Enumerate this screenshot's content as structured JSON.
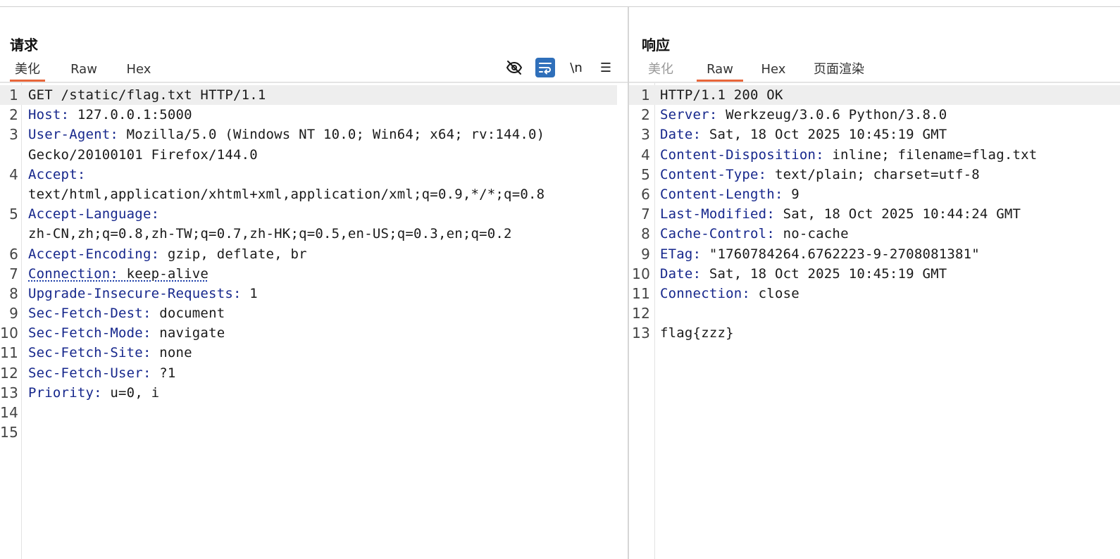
{
  "request": {
    "title": "请求",
    "tabs": [
      {
        "label": "美化",
        "active": true
      },
      {
        "label": "Raw",
        "active": false
      },
      {
        "label": "Hex",
        "active": false
      }
    ],
    "toolbar": [
      {
        "icon": "eye-slash-icon"
      },
      {
        "icon": "wrap-icon",
        "active": true
      },
      {
        "icon": "newline-icon",
        "label": "\\n"
      },
      {
        "icon": "menu-icon",
        "label": "☰"
      }
    ],
    "lines": [
      {
        "n": "1",
        "key": "",
        "sep": "",
        "val": "GET /static/flag.txt HTTP/1.1",
        "highlight": true
      },
      {
        "n": "2",
        "key": "Host",
        "sep": ":",
        "val": " 127.0.0.1:5000"
      },
      {
        "n": "3",
        "key": "User-Agent",
        "sep": ":",
        "val": " Mozilla/5.0 (Windows NT 10.0; Win64; x64; rv:144.0)"
      },
      {
        "n": "",
        "key": "",
        "sep": "",
        "val": "Gecko/20100101 Firefox/144.0"
      },
      {
        "n": "4",
        "key": "Accept",
        "sep": ":",
        "val": ""
      },
      {
        "n": "",
        "key": "",
        "sep": "",
        "val": "text/html,application/xhtml+xml,application/xml;q=0.9,*/*;q=0.8"
      },
      {
        "n": "5",
        "key": "Accept-Language",
        "sep": ":",
        "val": ""
      },
      {
        "n": "",
        "key": "",
        "sep": "",
        "val": "zh-CN,zh;q=0.8,zh-TW;q=0.7,zh-HK;q=0.5,en-US;q=0.3,en;q=0.2"
      },
      {
        "n": "6",
        "key": "Accept-Encoding",
        "sep": ":",
        "val": " gzip, deflate, br"
      },
      {
        "n": "7",
        "key": "Connection",
        "sep": ":",
        "val": " keep-alive",
        "dotted": true
      },
      {
        "n": "8",
        "key": "Upgrade-Insecure-Requests",
        "sep": ":",
        "val": " 1"
      },
      {
        "n": "9",
        "key": "Sec-Fetch-Dest",
        "sep": ":",
        "val": " document"
      },
      {
        "n": "10",
        "key": "Sec-Fetch-Mode",
        "sep": ":",
        "val": " navigate"
      },
      {
        "n": "11",
        "key": "Sec-Fetch-Site",
        "sep": ":",
        "val": " none"
      },
      {
        "n": "12",
        "key": "Sec-Fetch-User",
        "sep": ":",
        "val": " ?1"
      },
      {
        "n": "13",
        "key": "Priority",
        "sep": ":",
        "val": " u=0, i"
      },
      {
        "n": "14",
        "key": "",
        "sep": "",
        "val": ""
      },
      {
        "n": "15",
        "key": "",
        "sep": "",
        "val": ""
      }
    ]
  },
  "response": {
    "title": "响应",
    "tabs": [
      {
        "label": "美化",
        "active": false,
        "dim": true
      },
      {
        "label": "Raw",
        "active": true
      },
      {
        "label": "Hex",
        "active": false
      },
      {
        "label": "页面渲染",
        "active": false
      }
    ],
    "lines": [
      {
        "n": "1",
        "key": "",
        "sep": "",
        "val": "HTTP/1.1 200 OK",
        "highlight": true
      },
      {
        "n": "2",
        "key": "Server",
        "sep": ":",
        "val": " Werkzeug/3.0.6 Python/3.8.0"
      },
      {
        "n": "3",
        "key": "Date",
        "sep": ":",
        "val": " Sat, 18 Oct 2025 10:45:19 GMT"
      },
      {
        "n": "4",
        "key": "Content-Disposition",
        "sep": ":",
        "val": " inline; filename=flag.txt"
      },
      {
        "n": "5",
        "key": "Content-Type",
        "sep": ":",
        "val": " text/plain; charset=utf-8"
      },
      {
        "n": "6",
        "key": "Content-Length",
        "sep": ":",
        "val": " 9"
      },
      {
        "n": "7",
        "key": "Last-Modified",
        "sep": ":",
        "val": " Sat, 18 Oct 2025 10:44:24 GMT"
      },
      {
        "n": "8",
        "key": "Cache-Control",
        "sep": ":",
        "val": " no-cache"
      },
      {
        "n": "9",
        "key": "ETag",
        "sep": ":",
        "val": " \"1760784264.6762223-9-2708081381\""
      },
      {
        "n": "10",
        "key": "Date",
        "sep": ":",
        "val": " Sat, 18 Oct 2025 10:45:19 GMT"
      },
      {
        "n": "11",
        "key": "Connection",
        "sep": ":",
        "val": " close"
      },
      {
        "n": "12",
        "key": "",
        "sep": "",
        "val": ""
      },
      {
        "n": "13",
        "key": "",
        "sep": "",
        "val": "flag{zzz}"
      }
    ]
  },
  "colors": {
    "accent": "#e8663a",
    "key": "#16278c",
    "wrap_button": "#2f6fba"
  }
}
